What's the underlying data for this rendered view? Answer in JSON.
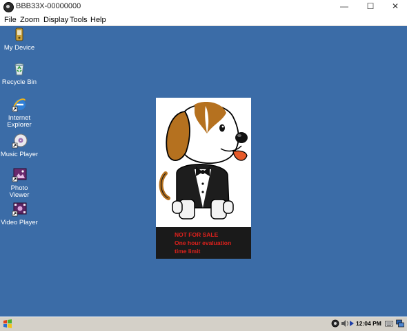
{
  "window": {
    "title": "BBB33X-00000000",
    "controls": {
      "minimize": "—",
      "maximize": "☐",
      "close": "✕"
    }
  },
  "menubar": {
    "items": [
      "File",
      "Zoom",
      "Display",
      "Tools",
      "Help"
    ]
  },
  "desktop": {
    "background_color": "#3b6ca7",
    "icons": [
      {
        "label": "My Device",
        "icon": "my-device-icon"
      },
      {
        "label": "Recycle Bin",
        "icon": "recycle-bin-icon"
      },
      {
        "label": "Internet Explorer",
        "icon": "internet-explorer-icon"
      },
      {
        "label": "Music Player",
        "icon": "music-player-icon"
      },
      {
        "label": "Photo Viewer",
        "icon": "photo-viewer-icon"
      },
      {
        "label": "Video Player",
        "icon": "video-player-icon"
      }
    ]
  },
  "splash": {
    "lines": [
      "NOT FOR SALE",
      "One hour evaluation",
      "time limit"
    ],
    "text_color": "#e0211c"
  },
  "taskbar": {
    "clock": "12:04 PM"
  }
}
